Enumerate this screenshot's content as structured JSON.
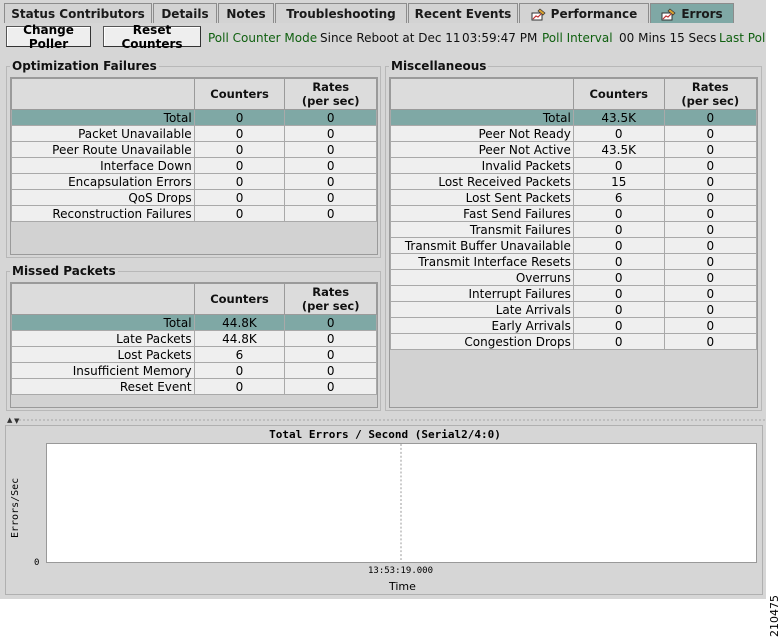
{
  "tabs": [
    {
      "label": "Status Contributors",
      "icon": "",
      "active": false
    },
    {
      "label": "Details",
      "icon": "",
      "active": false
    },
    {
      "label": "Notes",
      "icon": "",
      "active": false
    },
    {
      "label": "Troubleshooting",
      "icon": "",
      "active": false
    },
    {
      "label": "Recent Events",
      "icon": "",
      "active": false
    },
    {
      "label": "Performance",
      "icon": "chart-tool-icon",
      "active": false
    },
    {
      "label": "Errors",
      "icon": "chart-tool-icon",
      "active": true
    }
  ],
  "toolbar": {
    "change_poller": "Change Poller",
    "reset_counters": "Reset Counters",
    "poll_counter_mode_label": "Poll Counter Mode",
    "poll_counter_mode_value": "Since Reboot at Dec 11",
    "poll_time": "03:59:47 PM",
    "poll_interval_label": "Poll Interval",
    "poll_interval_value": "00 Mins 15 Secs",
    "last_poll_label": "Last Pol"
  },
  "columns": {
    "counters": "Counters",
    "rates_line1": "Rates",
    "rates_line2": "(per sec)"
  },
  "optimization_failures": {
    "title": "Optimization Failures",
    "rows": [
      {
        "label": "Total",
        "counters": "0",
        "rates": "0",
        "total": true
      },
      {
        "label": "Packet Unavailable",
        "counters": "0",
        "rates": "0"
      },
      {
        "label": "Peer Route Unavailable",
        "counters": "0",
        "rates": "0"
      },
      {
        "label": "Interface Down",
        "counters": "0",
        "rates": "0"
      },
      {
        "label": "Encapsulation Errors",
        "counters": "0",
        "rates": "0"
      },
      {
        "label": "QoS Drops",
        "counters": "0",
        "rates": "0"
      },
      {
        "label": "Reconstruction Failures",
        "counters": "0",
        "rates": "0"
      }
    ]
  },
  "missed_packets": {
    "title": "Missed Packets",
    "rows": [
      {
        "label": "Total",
        "counters": "44.8K",
        "rates": "0",
        "total": true
      },
      {
        "label": "Late Packets",
        "counters": "44.8K",
        "rates": "0"
      },
      {
        "label": "Lost Packets",
        "counters": "6",
        "rates": "0"
      },
      {
        "label": "Insufficient Memory",
        "counters": "0",
        "rates": "0"
      },
      {
        "label": "Reset Event",
        "counters": "0",
        "rates": "0"
      }
    ]
  },
  "miscellaneous": {
    "title": "Miscellaneous",
    "rows": [
      {
        "label": "Total",
        "counters": "43.5K",
        "rates": "0",
        "total": true
      },
      {
        "label": "Peer Not Ready",
        "counters": "0",
        "rates": "0"
      },
      {
        "label": "Peer Not Active",
        "counters": "43.5K",
        "rates": "0"
      },
      {
        "label": "Invalid Packets",
        "counters": "0",
        "rates": "0"
      },
      {
        "label": "Lost Received Packets",
        "counters": "15",
        "rates": "0"
      },
      {
        "label": "Lost Sent Packets",
        "counters": "6",
        "rates": "0"
      },
      {
        "label": "Fast Send Failures",
        "counters": "0",
        "rates": "0"
      },
      {
        "label": "Transmit Failures",
        "counters": "0",
        "rates": "0"
      },
      {
        "label": "Transmit Buffer Unavailable",
        "counters": "0",
        "rates": "0"
      },
      {
        "label": "Transmit Interface Resets",
        "counters": "0",
        "rates": "0"
      },
      {
        "label": "Overruns",
        "counters": "0",
        "rates": "0"
      },
      {
        "label": "Interrupt Failures",
        "counters": "0",
        "rates": "0"
      },
      {
        "label": "Late Arrivals",
        "counters": "0",
        "rates": "0"
      },
      {
        "label": "Early Arrivals",
        "counters": "0",
        "rates": "0"
      },
      {
        "label": "Congestion Drops",
        "counters": "0",
        "rates": "0"
      }
    ]
  },
  "chart": {
    "title": "Total Errors / Second  (Serial2/4:0)",
    "ylabel": "Errors/Sec",
    "ytick": "0",
    "xtick": "13:53:19.000",
    "xlabel": "Time"
  },
  "figure_id": "210475"
}
